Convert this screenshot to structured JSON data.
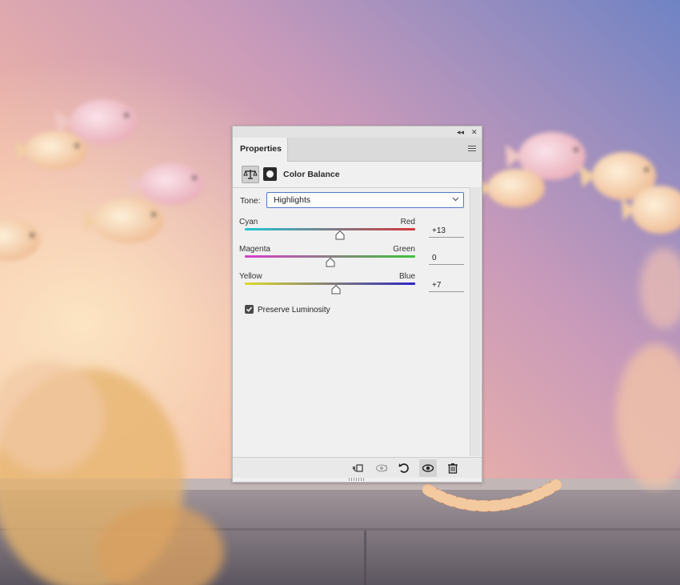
{
  "panel": {
    "tab_label": "Properties",
    "title": "Color Balance",
    "controls": {
      "collapse": "◂◂",
      "close": "✕"
    },
    "icons": {
      "adjustment": "scale-icon",
      "mask": "layer-mask-icon",
      "menu": "panel-menu-icon"
    }
  },
  "tone": {
    "label": "Tone:",
    "value": "Highlights"
  },
  "sliders": [
    {
      "left_label": "Cyan",
      "right_label": "Red",
      "value": "+13",
      "position_fraction": 0.561,
      "colors": [
        "#21c6d6",
        "#d6353a"
      ]
    },
    {
      "left_label": "Magenta",
      "right_label": "Green",
      "value": "0",
      "position_fraction": 0.5,
      "colors": [
        "#d93bcc",
        "#3dc43a"
      ]
    },
    {
      "left_label": "Yellow",
      "right_label": "Blue",
      "value": "+7",
      "position_fraction": 0.533,
      "colors": [
        "#dcd92c",
        "#2b25c2"
      ]
    }
  ],
  "preserve_luminosity": {
    "label": "Preserve Luminosity",
    "checked": true
  },
  "footer_icons": [
    "clip-to-layer-icon",
    "view-previous-state-icon",
    "reset-icon",
    "visibility-eye-icon",
    "trash-icon"
  ]
}
